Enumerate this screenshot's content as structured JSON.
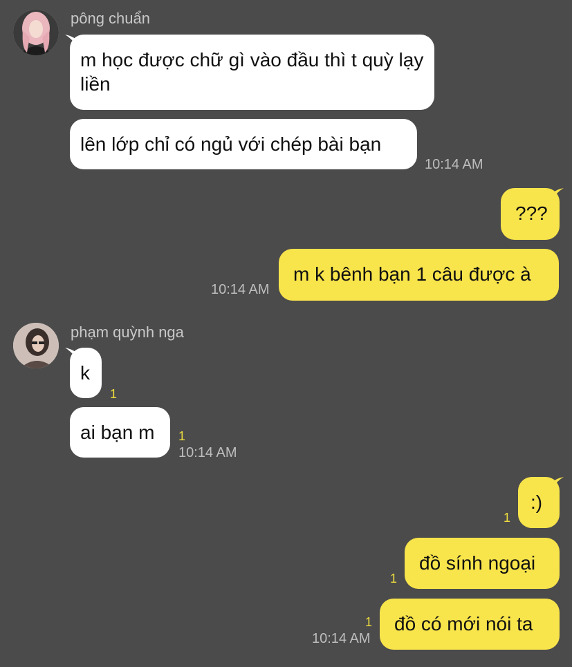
{
  "colors": {
    "background": "#4b4b4b",
    "incoming_bubble": "#ffffff",
    "outgoing_bubble": "#f8e44b",
    "unread_count": "#f1de3e",
    "timestamp": "#bdbdbd",
    "sender_name": "#c8c8c8"
  },
  "chat": {
    "groups": [
      {
        "sender": "pông chuẩn",
        "avatar": "pong-chuan-avatar",
        "messages": [
          {
            "text": "m học được chữ gì vào đầu thì t quỳ lạy liền"
          },
          {
            "text": "lên lớp chỉ có ngủ với chép bài bạn"
          }
        ],
        "time": "10:14 AM"
      },
      {
        "sender": "me",
        "messages": [
          {
            "text": "???"
          },
          {
            "text": "m k bênh bạn 1 câu được à"
          }
        ],
        "time": "10:14 AM"
      },
      {
        "sender": "phạm quỳnh nga",
        "avatar": "pham-quynh-nga-avatar",
        "messages": [
          {
            "text": "k",
            "unread": "1"
          },
          {
            "text": "ai bạn m",
            "unread": "1"
          }
        ],
        "time": "10:14 AM"
      },
      {
        "sender": "me",
        "messages": [
          {
            "text": ":)",
            "unread": "1"
          },
          {
            "text": "đồ sính ngoại",
            "unread": "1"
          },
          {
            "text": "đồ có mới nói ta",
            "unread": "1"
          }
        ],
        "time": "10:14 AM"
      }
    ]
  }
}
